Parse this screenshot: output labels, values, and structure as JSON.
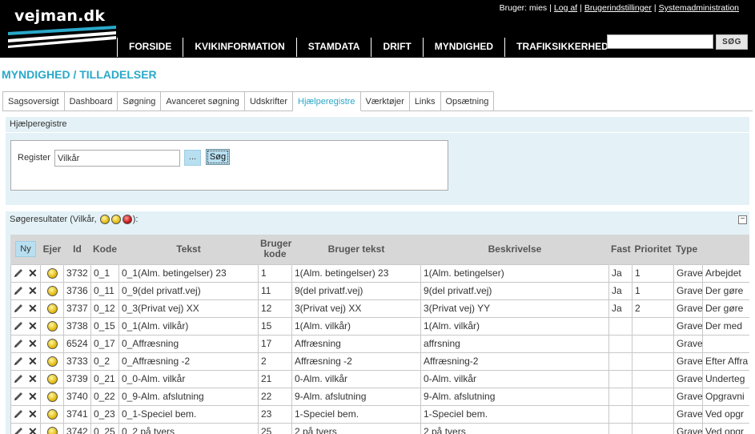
{
  "header": {
    "logo": "vejman.dk",
    "user_prefix": "Bruger: mies",
    "links": [
      "Log af",
      "Brugerindstillinger",
      "Systemadministration"
    ],
    "nav": [
      "FORSIDE",
      "KVIKINFORMATION",
      "STAMDATA",
      "DRIFT",
      "MYNDIGHED",
      "TRAFIKSIKKERHED"
    ],
    "search_value": "",
    "search_button": "SØG"
  },
  "page_title": "MYNDIGHED / TILLADELSER",
  "tabs": [
    "Sagsoversigt",
    "Dashboard",
    "Søgning",
    "Avanceret søgning",
    "Udskrifter",
    "Hjælperegistre",
    "Værktøjer",
    "Links",
    "Opsætning"
  ],
  "active_tab": "Hjælperegistre",
  "panel": {
    "title": "Hjælperegistre",
    "register_label": "Register",
    "register_value": "Vilkår",
    "dots_button": "...",
    "search_button": "Søg"
  },
  "results": {
    "title_prefix": "Søgeresultater (Vilkår,",
    "title_suffix": "):",
    "collapse_symbol": "−",
    "new_button": "Ny",
    "columns": {
      "ejer": "Ejer",
      "id": "Id",
      "kode": "Kode",
      "tekst": "Tekst",
      "bruger_kode": "Bruger kode",
      "bruger_tekst": "Bruger tekst",
      "beskrivelse": "Beskrivelse",
      "fast": "Fast",
      "prioritet": "Prioritet",
      "type": "Type"
    },
    "rows": [
      {
        "id": "3732",
        "kode": "0_1",
        "tekst": "0_1(Alm. betingelser) 23",
        "bruger_kode": "1",
        "bruger_tekst": "1(Alm. betingelser) 23",
        "beskrivelse": "1(Alm. betingelser)",
        "fast": "Ja",
        "prioritet": "1",
        "type": "Grave",
        "extra": "Arbejdet"
      },
      {
        "id": "3736",
        "kode": "0_11",
        "tekst": "0_9(del privatf.vej)",
        "bruger_kode": "11",
        "bruger_tekst": "9(del privatf.vej)",
        "beskrivelse": "9(del privatf.vej)",
        "fast": "Ja",
        "prioritet": "1",
        "type": "Grave",
        "extra": "Der gøre"
      },
      {
        "id": "3737",
        "kode": "0_12",
        "tekst": "0_3(Privat vej) XX",
        "bruger_kode": "12",
        "bruger_tekst": "3(Privat vej) XX",
        "beskrivelse": "3(Privat vej) YY",
        "fast": "Ja",
        "prioritet": "2",
        "type": "Grave",
        "extra": "Der gøre"
      },
      {
        "id": "3738",
        "kode": "0_15",
        "tekst": "0_1(Alm. vilkår)",
        "bruger_kode": "15",
        "bruger_tekst": "1(Alm. vilkår)",
        "beskrivelse": "1(Alm. vilkår)",
        "fast": "",
        "prioritet": "",
        "type": "Grave",
        "extra": "Der med"
      },
      {
        "id": "6524",
        "kode": "0_17",
        "tekst": "0_Affræsning",
        "bruger_kode": "17",
        "bruger_tekst": "Affræsning",
        "beskrivelse": "affrsning",
        "fast": "",
        "prioritet": "",
        "type": "Grave",
        "extra": ""
      },
      {
        "id": "3733",
        "kode": "0_2",
        "tekst": "0_Affræsning -2",
        "bruger_kode": "2",
        "bruger_tekst": "Affræsning -2",
        "beskrivelse": "Affræsning-2",
        "fast": "",
        "prioritet": "",
        "type": "Grave",
        "extra": "Efter Affra"
      },
      {
        "id": "3739",
        "kode": "0_21",
        "tekst": "0_0-Alm. vilkår",
        "bruger_kode": "21",
        "bruger_tekst": "0-Alm. vilkår",
        "beskrivelse": "0-Alm. vilkår",
        "fast": "",
        "prioritet": "",
        "type": "Grave",
        "extra": "Underteg"
      },
      {
        "id": "3740",
        "kode": "0_22",
        "tekst": "0_9-Alm. afslutning",
        "bruger_kode": "22",
        "bruger_tekst": "9-Alm. afslutning",
        "beskrivelse": "9-Alm. afslutning",
        "fast": "",
        "prioritet": "",
        "type": "Grave",
        "extra": "Opgravni"
      },
      {
        "id": "3741",
        "kode": "0_23",
        "tekst": "0_1-Speciel bem.",
        "bruger_kode": "23",
        "bruger_tekst": "1-Speciel bem.",
        "beskrivelse": "1-Speciel bem.",
        "fast": "",
        "prioritet": "",
        "type": "Grave",
        "extra": "Ved opgr"
      },
      {
        "id": "3742",
        "kode": "0_25",
        "tekst": "0_2 på tvers",
        "bruger_kode": "25",
        "bruger_tekst": "2 på tvers",
        "beskrivelse": "2 på tvers",
        "fast": "",
        "prioritet": "",
        "type": "Grave",
        "extra": "Ved opgr"
      }
    ]
  }
}
